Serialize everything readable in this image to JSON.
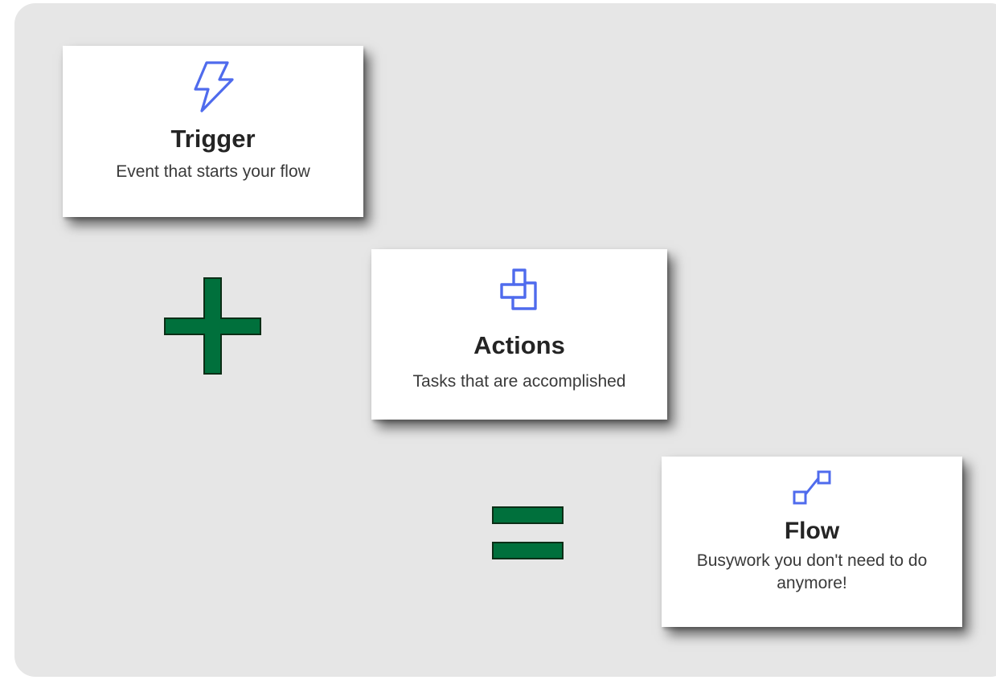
{
  "cards": {
    "trigger": {
      "title": "Trigger",
      "description": "Event that starts your flow",
      "icon": "lightning-bolt-icon"
    },
    "actions": {
      "title": "Actions",
      "description": "Tasks that are accomplished",
      "icon": "steps-icon"
    },
    "flow": {
      "title": "Flow",
      "description_line1": "Busywork you don't need to do",
      "description_line2": "anymore!",
      "icon": "flow-connector-icon"
    }
  },
  "operators": {
    "plus": "plus-sign",
    "equals": "equals-sign"
  },
  "colors": {
    "background": "#e6e6e6",
    "card": "#ffffff",
    "icon_blue": "#4f6bed",
    "operator_green": "#00703c",
    "operator_outline": "#0b2e16"
  }
}
